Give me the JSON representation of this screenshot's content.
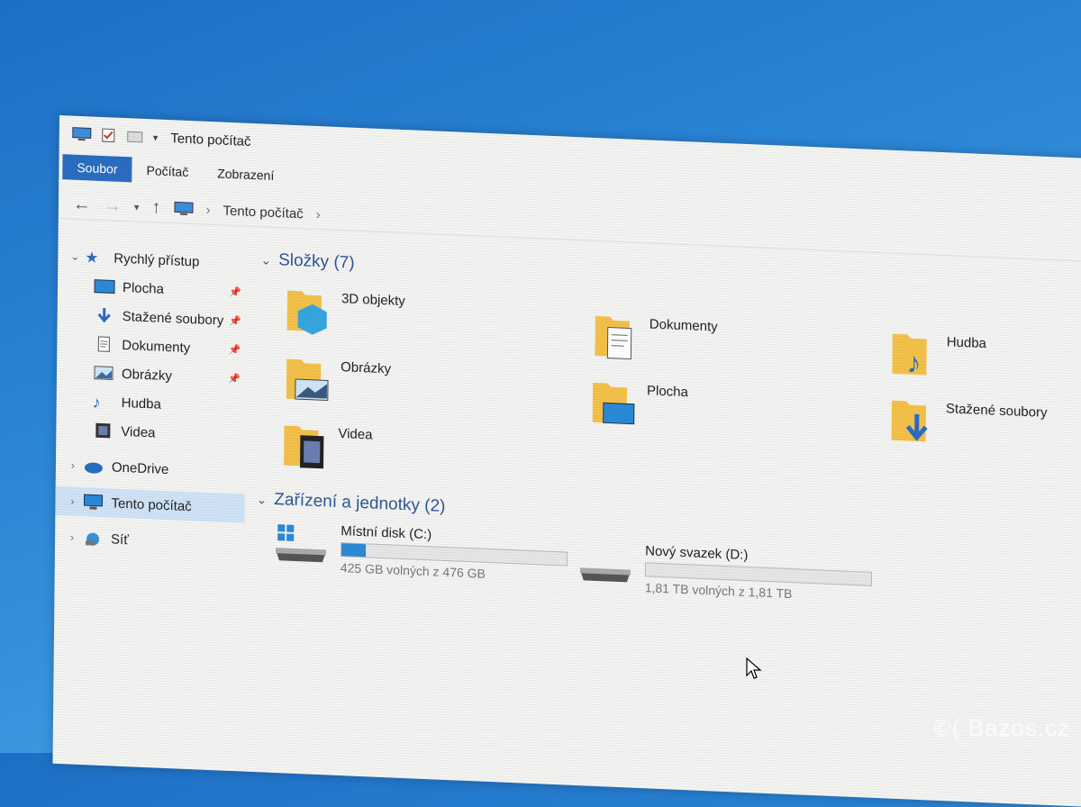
{
  "window": {
    "title": "Tento počítač"
  },
  "ribbon": {
    "tabs": [
      {
        "label": "Soubor"
      },
      {
        "label": "Počítač"
      },
      {
        "label": "Zobrazení"
      }
    ]
  },
  "address": {
    "crumb": "Tento počítač"
  },
  "nav": {
    "quick_access": "Rychlý přístup",
    "items": [
      {
        "label": "Plocha",
        "pinned": true
      },
      {
        "label": "Stažené soubory",
        "pinned": true
      },
      {
        "label": "Dokumenty",
        "pinned": true
      },
      {
        "label": "Obrázky",
        "pinned": true
      },
      {
        "label": "Hudba"
      },
      {
        "label": "Videa"
      }
    ],
    "onedrive": "OneDrive",
    "this_pc": "Tento počítač",
    "network": "Síť"
  },
  "groups": {
    "folders": "Složky (7)",
    "drives": "Zařízení a jednotky (2)"
  },
  "folders": [
    {
      "label": "3D objekty",
      "icon": "3d-objects-icon"
    },
    {
      "label": "Dokumenty",
      "icon": "documents-icon"
    },
    {
      "label": "Hudba",
      "icon": "music-icon"
    },
    {
      "label": "Obrázky",
      "icon": "pictures-icon"
    },
    {
      "label": "Plocha",
      "icon": "desktop-icon"
    },
    {
      "label": "Stažené soubory",
      "icon": "downloads-icon"
    },
    {
      "label": "Videa",
      "icon": "videos-icon"
    }
  ],
  "drives": [
    {
      "name": "Místní disk (C:)",
      "free_text": "425 GB volných z 476 GB",
      "used_fraction": 0.107
    },
    {
      "name": "Nový svazek (D:)",
      "free_text": "1,81 TB volných z 1,81 TB",
      "used_fraction": 0.0
    }
  ],
  "watermark": "©( Bazos.cz",
  "colors": {
    "accent": "#2a6dc0",
    "folder": "#f3c14a",
    "group_header": "#2f5597",
    "drive_bar": "#2a8ad6"
  }
}
